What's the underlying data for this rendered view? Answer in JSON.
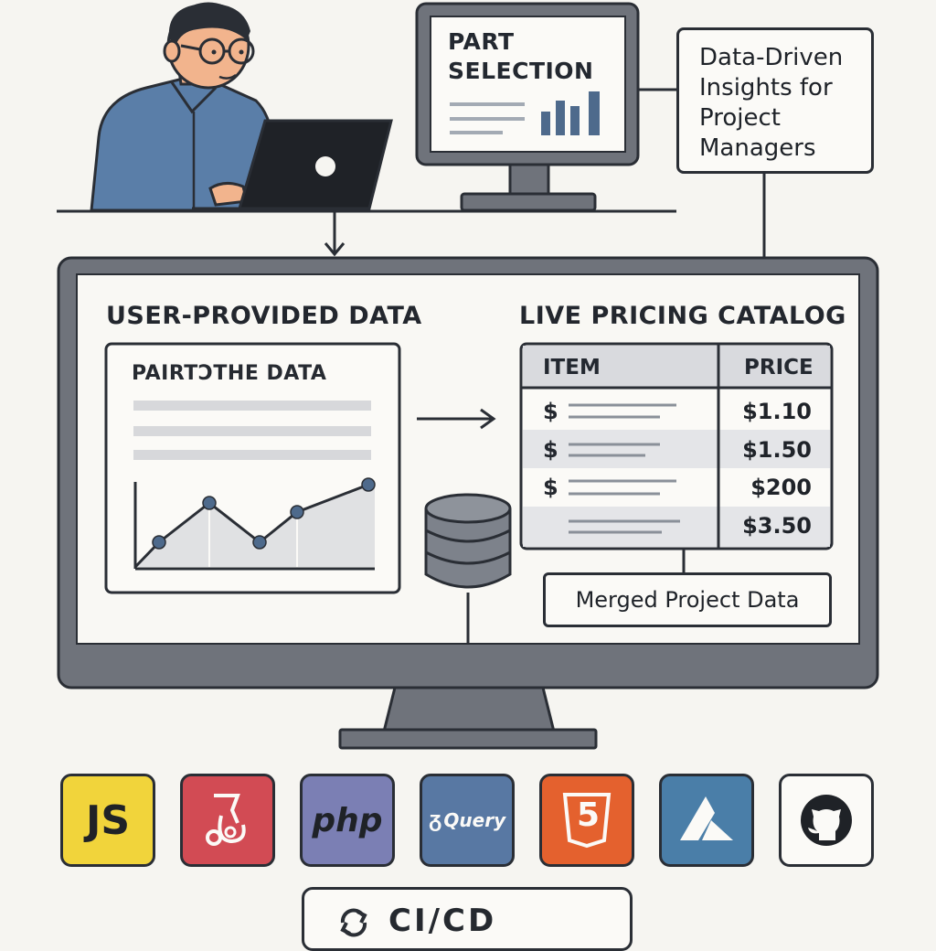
{
  "top_monitor": {
    "title_line1": "PART",
    "title_line2": "SELECTION"
  },
  "insight_box": {
    "lines": [
      "Data-Driven",
      "Insights for",
      "Project",
      "Managers"
    ]
  },
  "user_section": {
    "title": "USER-PROVIDED DATA",
    "card_title": "PAIRTƆTHE DATA"
  },
  "catalog": {
    "title": "LIVE PRICING CATALOG",
    "headers": {
      "item": "ITEM",
      "price": "PRICE"
    },
    "rows": [
      {
        "symbol": "$",
        "price": "$1.10"
      },
      {
        "symbol": "$",
        "price": "$1.50"
      },
      {
        "symbol": "$",
        "price": "$200"
      },
      {
        "symbol": "",
        "price": "$3.50"
      }
    ]
  },
  "merged": {
    "label": "Merged Project Data"
  },
  "tech_tiles": [
    {
      "label": "JS",
      "icon": "javascript-icon",
      "color": "#f1d43b"
    },
    {
      "label": "",
      "icon": "jest-icon",
      "color": "#d24b54"
    },
    {
      "label": "php",
      "icon": "php-icon",
      "color": "#7b7fb4"
    },
    {
      "label": "Query",
      "icon": "jquery-icon",
      "color": "#5878a3"
    },
    {
      "label": "5",
      "icon": "html5-icon",
      "color": "#e4612e"
    },
    {
      "label": "",
      "icon": "azure-icon",
      "color": "#4a7ea8"
    },
    {
      "label": "",
      "icon": "github-icon",
      "color": "#fbfaf7"
    }
  ],
  "cicd": {
    "label": "CI/CD",
    "icon": "refresh-icon"
  },
  "colors": {
    "background": "#f6f5f1",
    "monitor_frame": "#6f737b",
    "outline": "#2a2e35",
    "accent_bar": "#4e6a8c"
  }
}
